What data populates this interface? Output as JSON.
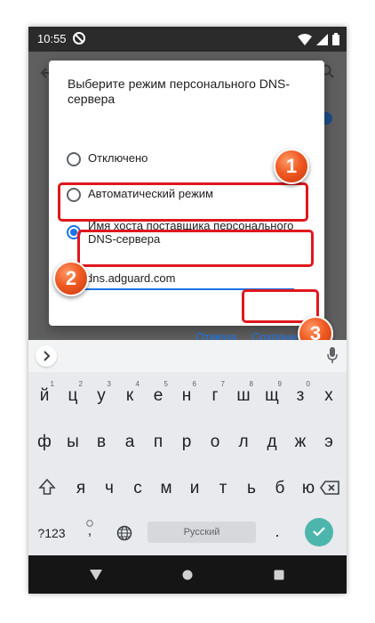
{
  "status_bar": {
    "time": "10:55"
  },
  "dialog": {
    "title": "Выберите режим персонального DNS-сервера",
    "options": [
      {
        "label": "Отключено",
        "selected": false
      },
      {
        "label": "Автоматический режим",
        "selected": false
      },
      {
        "label": "Имя хоста поставщика персонального DNS-сервера",
        "selected": true
      }
    ],
    "hostname_value": "dns.adguard.com",
    "cancel_label": "Отмена",
    "save_label": "Сохранить"
  },
  "callouts": [
    "1",
    "2",
    "3"
  ],
  "keyboard": {
    "row1": [
      {
        "key": "й",
        "hint": "1"
      },
      {
        "key": "ц",
        "hint": "2"
      },
      {
        "key": "у",
        "hint": "3"
      },
      {
        "key": "к",
        "hint": "4"
      },
      {
        "key": "е",
        "hint": "5"
      },
      {
        "key": "н",
        "hint": "6"
      },
      {
        "key": "г",
        "hint": "7"
      },
      {
        "key": "ш",
        "hint": "8"
      },
      {
        "key": "щ",
        "hint": "9"
      },
      {
        "key": "з",
        "hint": "0"
      },
      {
        "key": "х",
        "hint": ""
      }
    ],
    "row2": [
      "ф",
      "ы",
      "в",
      "а",
      "п",
      "р",
      "о",
      "л",
      "д",
      "ж",
      "э"
    ],
    "row3": [
      "я",
      "ч",
      "с",
      "м",
      "и",
      "т",
      "ь",
      "б",
      "ю"
    ],
    "symbols_label": "?123",
    "comma_label": ",",
    "period_label": ".",
    "space_label": "Русский"
  },
  "colors": {
    "accent": "#1a73e8",
    "callout_red": "#e0171d",
    "callout_orange": "#f05a22",
    "enter": "#4db6ac"
  },
  "icons": [
    "dnd-icon",
    "wifi-icon",
    "signal-icon",
    "battery-icon",
    "chevron-right-icon",
    "mic-icon",
    "shift-icon",
    "backspace-icon",
    "emoji-icon",
    "globe-icon",
    "check-icon",
    "nav-back-icon",
    "nav-home-icon",
    "nav-recents-icon"
  ]
}
